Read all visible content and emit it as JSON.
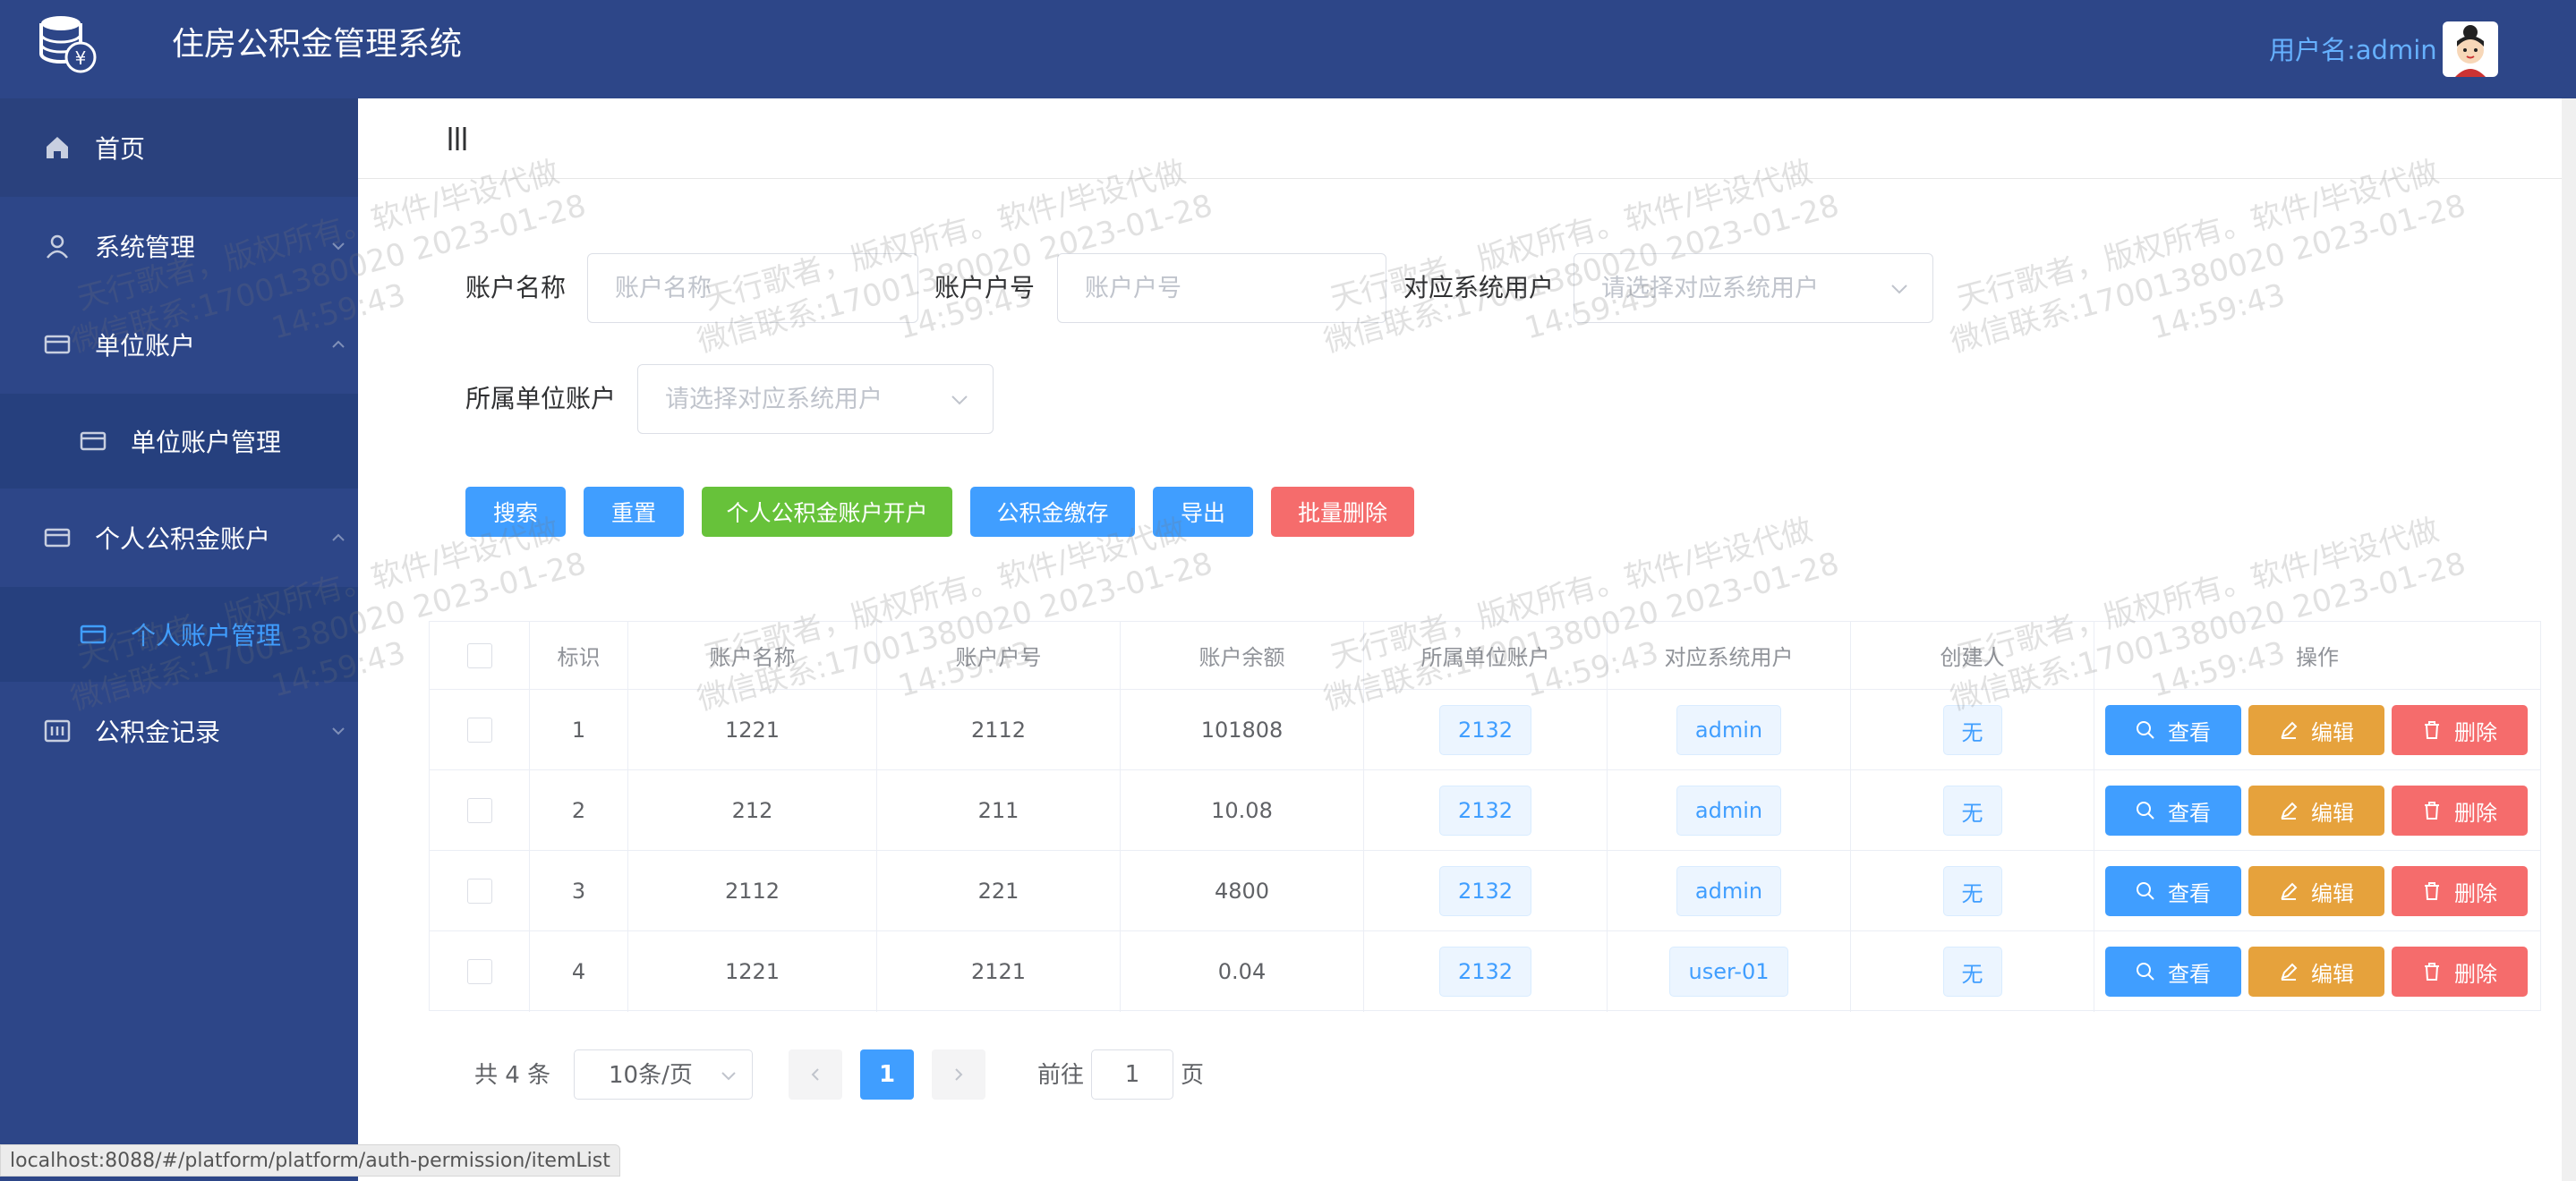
{
  "header": {
    "title": "住房公积金管理系统",
    "user_label": "用户名:admin"
  },
  "sidebar": {
    "items": [
      {
        "label": "首页",
        "icon": "home-icon"
      },
      {
        "label": "系统管理",
        "icon": "user-icon"
      },
      {
        "label": "单位账户",
        "icon": "card-icon"
      },
      {
        "label": "单位账户管理",
        "icon": "card-icon"
      },
      {
        "label": "个人公积金账户",
        "icon": "card-icon"
      },
      {
        "label": "个人账户管理",
        "icon": "card-icon"
      },
      {
        "label": "公积金记录",
        "icon": "record-icon"
      }
    ]
  },
  "filters": {
    "account_name_label": "账户名称",
    "account_name_placeholder": "账户名称",
    "account_no_label": "账户户号",
    "account_no_placeholder": "账户户号",
    "system_user_label": "对应系统用户",
    "system_user_placeholder": "请选择对应系统用户",
    "unit_account_label": "所属单位账户",
    "unit_account_placeholder": "请选择对应系统用户"
  },
  "toolbar": {
    "search": "搜索",
    "reset": "重置",
    "open_account": "个人公积金账户开户",
    "deposit": "公积金缴存",
    "export": "导出",
    "batch_delete": "批量删除"
  },
  "table": {
    "headers": [
      "标识",
      "账户名称",
      "账户户号",
      "账户余额",
      "所属单位账户",
      "对应系统用户",
      "创建人",
      "操作"
    ],
    "rows": [
      {
        "id": "1",
        "name": "1221",
        "no": "2112",
        "balance": "101808",
        "unit": "2132",
        "user": "admin",
        "creator": "无"
      },
      {
        "id": "2",
        "name": "212",
        "no": "211",
        "balance": "10.08",
        "unit": "2132",
        "user": "admin",
        "creator": "无"
      },
      {
        "id": "3",
        "name": "2112",
        "no": "221",
        "balance": "4800",
        "unit": "2132",
        "user": "admin",
        "creator": "无"
      },
      {
        "id": "4",
        "name": "1221",
        "no": "2121",
        "balance": "0.04",
        "unit": "2132",
        "user": "user-01",
        "creator": "无"
      }
    ],
    "actions": {
      "view": "查看",
      "edit": "编辑",
      "delete": "删除"
    }
  },
  "pagination": {
    "total": "共 4 条",
    "page_size": "10条/页",
    "current_page": "1",
    "goto_label": "前往",
    "goto_value": "1",
    "page_suffix": "页"
  },
  "status_url": "localhost:8088/#/platform/platform/auth-permission/itemList",
  "watermark": {
    "line1": "天行歌者，版权所有。软件/毕设代做",
    "line2": "微信联系:17001380020 2023-01-28",
    "line3": "14:59:43"
  },
  "colors": {
    "sidebar": "#2d4688",
    "primary": "#409eff",
    "success": "#67c23a",
    "warning": "#e6a23c",
    "danger": "#f56c6c"
  }
}
